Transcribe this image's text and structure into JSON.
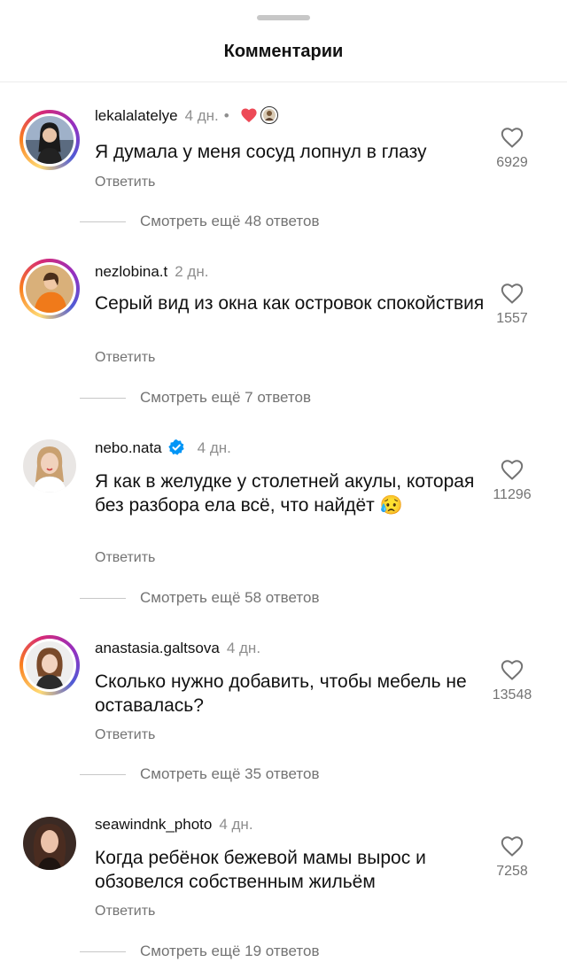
{
  "header": {
    "title": "Комментарии"
  },
  "comments": [
    {
      "username": "lekalalatelye",
      "time": "4 дн.",
      "dot": "•",
      "text": "Я думала у меня сосуд лопнул в глазу",
      "reply_label": "Ответить",
      "likes": "6929",
      "view_more": "Смотреть ещё 48 ответов"
    },
    {
      "username": "nezlobina.t",
      "time": "2 дн.",
      "text": "Серый вид из окна как островок спокойствия",
      "reply_label": "Ответить",
      "likes": "1557",
      "view_more": "Смотреть ещё 7 ответов"
    },
    {
      "username": "nebo.nata",
      "time": "4 дн.",
      "text": "Я как в желудке у столетней акулы, которая без разбора ела всё, что найдёт 😥",
      "reply_label": "Ответить",
      "likes": "11296",
      "view_more": "Смотреть ещё 58 ответов"
    },
    {
      "username": "anastasia.galtsova",
      "time": "4 дн.",
      "text": "Сколько нужно добавить, чтобы мебель не оставалась?",
      "reply_label": "Ответить",
      "likes": "13548",
      "view_more": "Смотреть ещё 35 ответов"
    },
    {
      "username": "seawindnk_photo",
      "time": "4 дн.",
      "text": "Когда ребёнок бежевой мамы вырос и обзовелся собственным жильём",
      "reply_label": "Ответить",
      "likes": "7258",
      "view_more": "Смотреть ещё 19 ответов"
    }
  ],
  "icons": {
    "like": "heart-outline-icon",
    "verified": "verified-badge-icon",
    "creator_like": "red-heart-icon"
  },
  "colors": {
    "verified": "#0095f6",
    "heart": "#ed4956",
    "muted": "#737373"
  }
}
